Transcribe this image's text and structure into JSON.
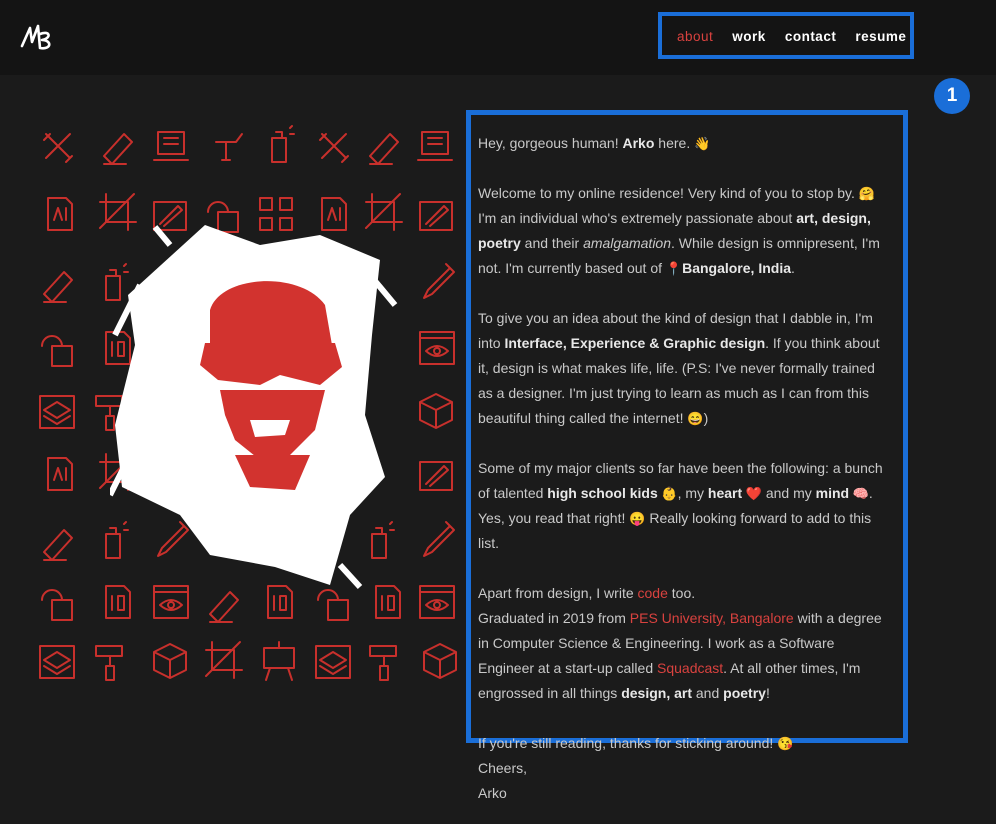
{
  "nav": {
    "about": "about",
    "work": "work",
    "contact": "contact",
    "resume": "resume"
  },
  "badge": "1",
  "logo_name": "signature-logo",
  "colors": {
    "accent": "#d9423f",
    "highlight": "#1a6ed8",
    "background": "#1b1b1b"
  },
  "about": {
    "p1": {
      "a": "Hey, gorgeous human! ",
      "b": "Arko",
      "c": " here. ",
      "emoji": "👋"
    },
    "p2": {
      "a": "Welcome to my online residence! Very kind of you to stop by. ",
      "e1": "🤗",
      "b": "I'm an individual who's extremely passionate about ",
      "bold1": "art, design, poetry",
      "c": " and their ",
      "ital": "amalgamation",
      "d": ". While design is omnipresent, I'm not. I'm currently based out of ",
      "pin": "📍",
      "bold2": "Bangalore, India",
      "e": "."
    },
    "p3": {
      "a": "To give you an idea about the kind of design that I dabble in, I'm into ",
      "bold": "Interface, Experience & Graphic design",
      "b": ". If you think about it, design is what makes life, life. (P.S: I've never formally trained as a designer. I'm just trying to learn as much as I can from this beautiful thing called the internet! ",
      "emoji": "😄",
      "c": ")"
    },
    "p4": {
      "a": "Some of my major clients so far have been the following: a bunch of talented ",
      "b1": "high school kids",
      "e1": " 👶",
      "b": ", my ",
      "b2": "heart",
      "e2": " ❤️",
      "c": " and my ",
      "b3": "mind",
      "e3": " 🧠",
      "d": ". Yes, you read that right! ",
      "e4": "😛",
      "e": " Really looking forward to add to this list."
    },
    "p5": {
      "a": "Apart from design, I write ",
      "link1": "code",
      "b": " too.",
      "c": "Graduated in 2019 from ",
      "link2": "PES University, Bangalore",
      "d": " with a degree in Computer Science & Engineering. I work as a Software Engineer at a start-up called ",
      "link3": "Squadcast",
      "e": ". At all other times, I'm engrossed in all things ",
      "b1": "design, art",
      "f": " and ",
      "b2": "poetry",
      "g": "!"
    },
    "p6": {
      "a": "If you're still reading, thanks for sticking around! ",
      "emoji": "😘"
    }
  },
  "signoff": {
    "line1": "Cheers,",
    "line2": "Arko"
  },
  "icon_set": [
    "pencil-ruler-icon",
    "eraser-icon",
    "laptop-icon",
    "pen-tool-icon",
    "spray-can-icon",
    "ai-file-icon",
    "crop-icon",
    "image-edit-icon",
    "shapes-icon",
    "grid-icon",
    "dropper-icon",
    "id-file-icon",
    "eye-window-icon",
    "layers-icon",
    "paint-roller-icon",
    "cube-icon",
    "easel-icon"
  ]
}
